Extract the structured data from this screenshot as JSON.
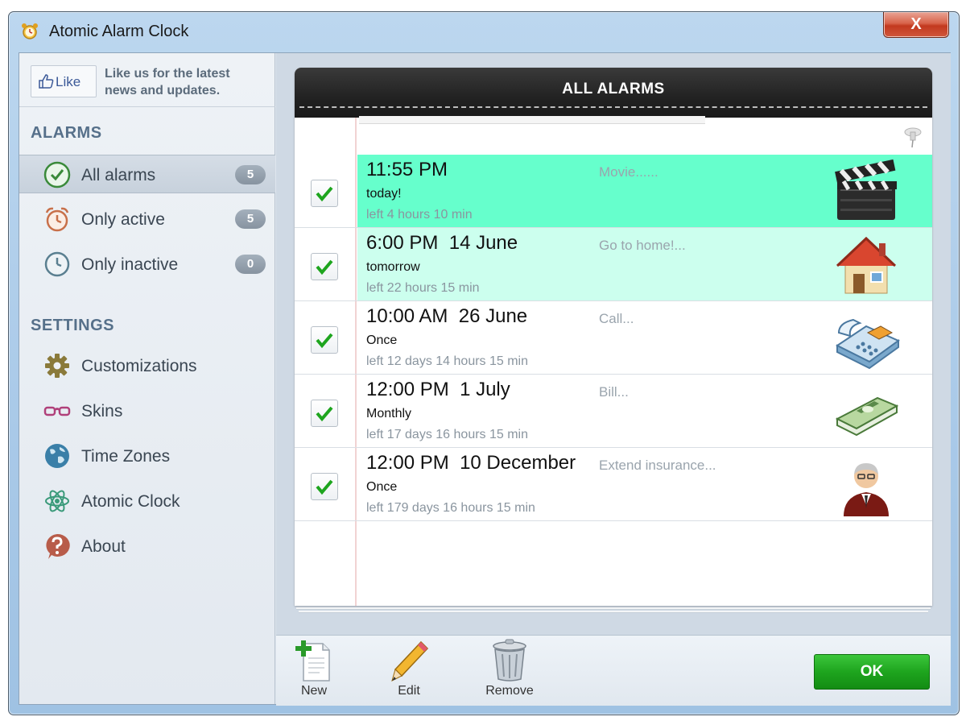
{
  "window": {
    "title": "Atomic Alarm Clock",
    "close_label": "X"
  },
  "sidebar": {
    "like_button": "Like",
    "like_text": "Like us for the latest news and updates.",
    "alarms_heading": "ALARMS",
    "alarm_filters": [
      {
        "label": "All alarms",
        "count": "5",
        "icon": "clock-check-icon",
        "selected": true
      },
      {
        "label": "Only active",
        "count": "5",
        "icon": "alarm-clock-icon",
        "selected": false
      },
      {
        "label": "Only inactive",
        "count": "0",
        "icon": "clock-icon",
        "selected": false
      }
    ],
    "settings_heading": "SETTINGS",
    "settings_items": [
      {
        "label": "Customizations",
        "icon": "gear-icon"
      },
      {
        "label": "Skins",
        "icon": "glasses-icon"
      },
      {
        "label": "Time Zones",
        "icon": "globe-icon"
      },
      {
        "label": "Atomic Clock",
        "icon": "atom-icon"
      },
      {
        "label": "About",
        "icon": "question-icon"
      }
    ]
  },
  "main": {
    "header_title": "ALL ALARMS",
    "alarms": [
      {
        "time": "11:55 PM",
        "repeat": "today!",
        "left": "left 4 hours 10 min",
        "note": "Movie......",
        "picture": "clapperboard-icon",
        "checked": true,
        "highlight": "#66ffcc"
      },
      {
        "time": "6:00 PM  14 June",
        "repeat": "tomorrow",
        "left": "left 22 hours 15 min",
        "note": "Go to home!...",
        "picture": "house-icon",
        "checked": true,
        "highlight": "#ccffee"
      },
      {
        "time": "10:00 AM  26 June",
        "repeat": "Once",
        "left": "left 12 days 14 hours 15 min",
        "note": "Call...",
        "picture": "telephone-icon",
        "checked": true,
        "highlight": ""
      },
      {
        "time": "12:00 PM  1 July",
        "repeat": "Monthly",
        "left": "left 17 days 16 hours 15 min",
        "note": "Bill...",
        "picture": "money-icon",
        "checked": true,
        "highlight": ""
      },
      {
        "time": "12:00 PM  10 December",
        "repeat": "Once",
        "left": "left 179 days 16 hours 15 min",
        "note": "Extend insurance...",
        "picture": "person-icon",
        "checked": true,
        "highlight": ""
      }
    ]
  },
  "toolbar": {
    "new_label": "New",
    "edit_label": "Edit",
    "remove_label": "Remove",
    "ok_label": "OK"
  },
  "colors": {
    "accent_green": "#1ea51e",
    "active_row": "#66ffcc",
    "soon_row": "#ccffee",
    "heading": "#56708a"
  }
}
